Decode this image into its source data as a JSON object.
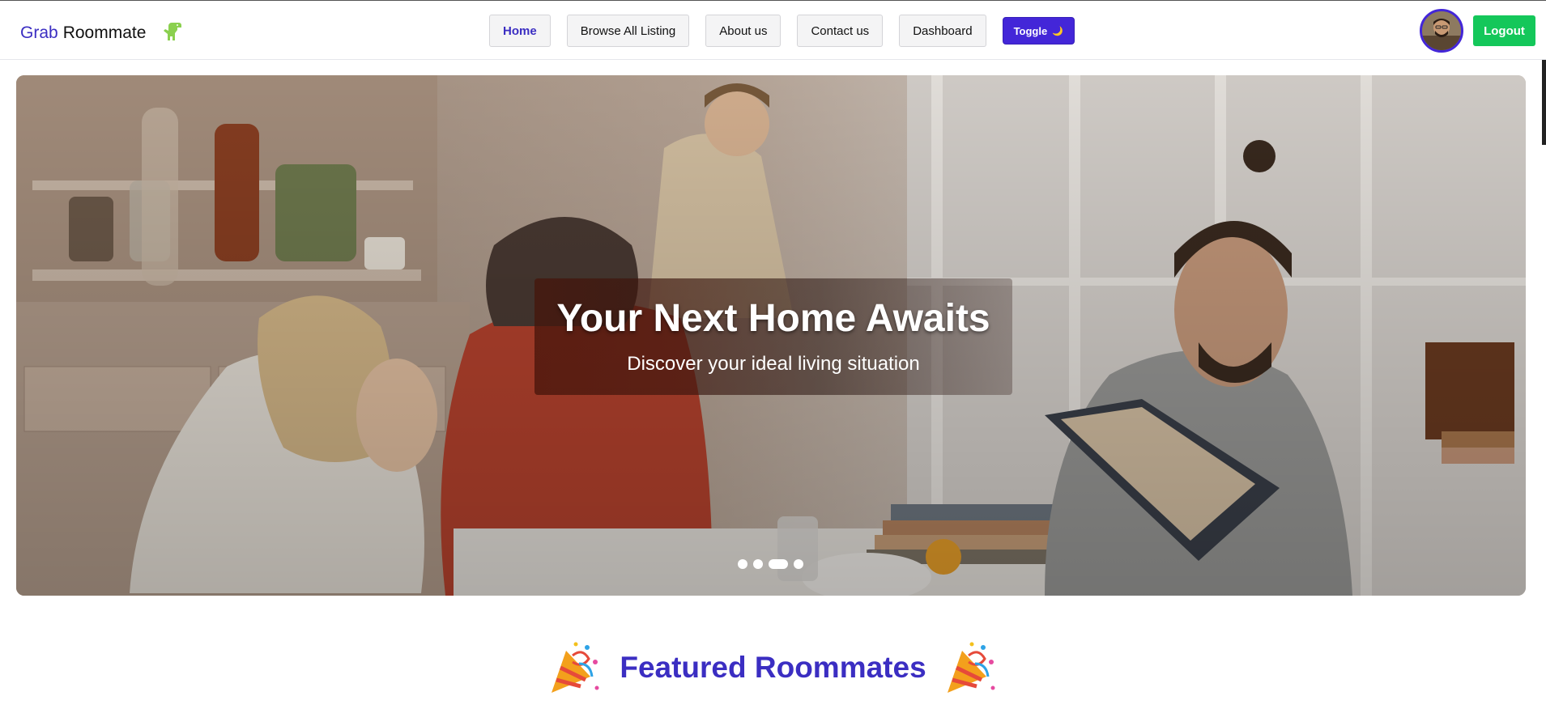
{
  "brand": {
    "word1": "Grab",
    "word2": "Roommate",
    "logo_icon": "dinosaur-icon"
  },
  "nav": {
    "items": [
      {
        "label": "Home",
        "active": true
      },
      {
        "label": "Browse All Listing",
        "active": false
      },
      {
        "label": "About us",
        "active": false
      },
      {
        "label": "Contact us",
        "active": false
      },
      {
        "label": "Dashboard",
        "active": false
      }
    ],
    "toggle_label": "Toggle",
    "toggle_icon": "🌙"
  },
  "user": {
    "avatar_icon": "user-avatar",
    "logout_label": "Logout"
  },
  "hero": {
    "title": "Your Next Home Awaits",
    "subtitle": "Discover your ideal living situation",
    "slide_count": 4,
    "active_slide_index": 2
  },
  "featured": {
    "title": "Featured Roommates",
    "icon": "party-popper-icon"
  },
  "colors": {
    "primary": "#4326d8",
    "brand_text": "#3b2ec2",
    "logout_bg": "#14c75a"
  }
}
